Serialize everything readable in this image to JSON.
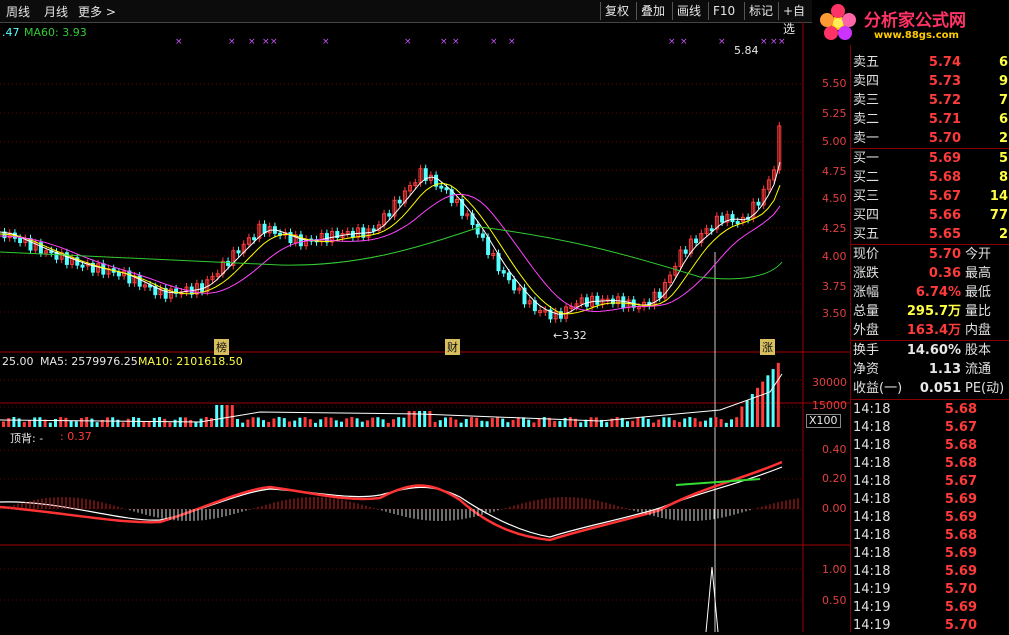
{
  "toolbar": {
    "left_items": [
      "周线",
      "月线",
      "更多 >"
    ],
    "buttons": [
      "复权",
      "叠加",
      "画线",
      "F10",
      "标记",
      "+自选"
    ]
  },
  "logo": {
    "title": "分析家公式网",
    "url": "www.88gs.com"
  },
  "main_chart": {
    "header_prefix": ".47",
    "ma60_label": "MA60: 3.93",
    "price_axis": [
      "5.50",
      "5.25",
      "5.00",
      "4.75",
      "4.50",
      "4.25",
      "4.00",
      "3.75",
      "3.50"
    ],
    "high_label": "5.84",
    "low_label": "←3.32",
    "markers": [
      "榜",
      "财",
      "涨"
    ]
  },
  "volume_panel": {
    "header_vol": "25.00",
    "ma5": "MA5: 2579976.25",
    "ma10": "MA10: 2101618.50",
    "axis": [
      "30000",
      "15000"
    ],
    "unit": "X100"
  },
  "indicator_panel": {
    "name": "顶背: -",
    "value": ": 0.37",
    "axis": [
      "0.40",
      "0.20",
      "0.00"
    ]
  },
  "bottom_panel": {
    "axis": [
      "1.00",
      "0.50"
    ]
  },
  "order_book": {
    "sell": [
      {
        "label": "卖五",
        "price": "5.74",
        "vol": "6"
      },
      {
        "label": "卖四",
        "price": "5.73",
        "vol": "9"
      },
      {
        "label": "卖三",
        "price": "5.72",
        "vol": "7"
      },
      {
        "label": "卖二",
        "price": "5.71",
        "vol": "6"
      },
      {
        "label": "卖一",
        "price": "5.70",
        "vol": "2"
      }
    ],
    "buy": [
      {
        "label": "买一",
        "price": "5.69",
        "vol": "5"
      },
      {
        "label": "买二",
        "price": "5.68",
        "vol": "8"
      },
      {
        "label": "买三",
        "price": "5.67",
        "vol": "14"
      },
      {
        "label": "买四",
        "price": "5.66",
        "vol": "77"
      },
      {
        "label": "买五",
        "price": "5.65",
        "vol": "2"
      }
    ]
  },
  "quote": [
    {
      "l1": "现价",
      "v": "5.70",
      "l2": "今开",
      "color": "#ff3b3b"
    },
    {
      "l1": "涨跌",
      "v": "0.36",
      "l2": "最高",
      "color": "#ff3b3b"
    },
    {
      "l1": "涨幅",
      "v": "6.74%",
      "l2": "最低",
      "color": "#ff3b3b"
    },
    {
      "l1": "总量",
      "v": "295.7万",
      "l2": "量比",
      "color": "#ffff44"
    },
    {
      "l1": "外盘",
      "v": "163.4万",
      "l2": "内盘",
      "color": "#ff3b3b"
    }
  ],
  "stats": [
    {
      "l1": "换手",
      "v": "14.60%",
      "l2": "股本"
    },
    {
      "l1": "净资",
      "v": "1.13",
      "l2": "流通"
    },
    {
      "l1": "收益(一)",
      "v": "0.051",
      "l2": "PE(动)"
    }
  ],
  "ticks": [
    {
      "time": "14:18",
      "price": "5.68"
    },
    {
      "time": "14:18",
      "price": "5.67"
    },
    {
      "time": "14:18",
      "price": "5.68"
    },
    {
      "time": "14:18",
      "price": "5.68"
    },
    {
      "time": "14:18",
      "price": "5.67"
    },
    {
      "time": "14:18",
      "price": "5.69"
    },
    {
      "time": "14:18",
      "price": "5.69"
    },
    {
      "time": "14:18",
      "price": "5.68"
    },
    {
      "time": "14:18",
      "price": "5.69"
    },
    {
      "time": "14:18",
      "price": "5.69"
    },
    {
      "time": "14:19",
      "price": "5.70"
    },
    {
      "time": "14:19",
      "price": "5.69"
    },
    {
      "time": "14:19",
      "price": "5.70"
    }
  ],
  "colors": {
    "up": "#ff3b3b",
    "down": "#55ffff",
    "ma5": "#ffffff",
    "ma10": "#ffff00",
    "ma20": "#ff44ff",
    "ma60": "#33cc33",
    "grid": "#8a0000"
  }
}
